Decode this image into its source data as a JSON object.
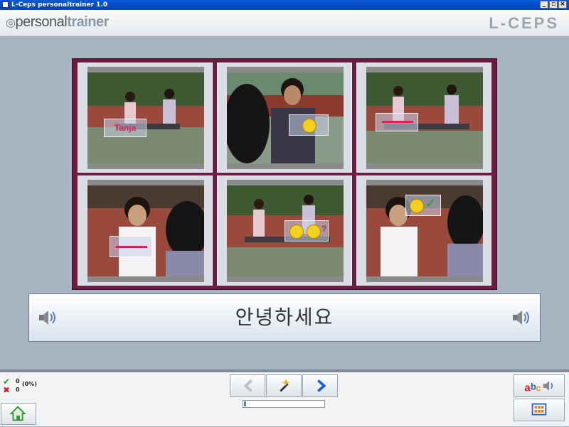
{
  "window": {
    "title": "L-Ceps personaltrainer 1.0"
  },
  "header": {
    "logo_left_part1": "personal",
    "logo_left_part2": "trainer",
    "logo_right": "L-CEPS"
  },
  "tiles": [
    {
      "overlay_text": "Tanja"
    },
    {
      "overlay_text": ""
    },
    {
      "overlay_text": ""
    },
    {
      "overlay_text": ""
    },
    {
      "overlay_text": ""
    },
    {
      "overlay_text": ""
    }
  ],
  "phrase": {
    "text": "안녕하세요"
  },
  "score": {
    "correct": "0",
    "wrong": "0",
    "percent": "(0%)"
  },
  "progress": {
    "value": 0.03
  },
  "icons": {
    "speaker_left": "speaker-icon",
    "speaker_right": "speaker-icon",
    "back": "arrow-left-icon",
    "hint": "magic-wand-icon",
    "next": "arrow-right-icon",
    "home": "home-icon",
    "abc_audio": "abc-audio-icon",
    "grid": "grid-icon"
  },
  "colors": {
    "frame": "#6b1c40",
    "accent_blue": "#1e5fd8",
    "background": "#a7b5c2"
  }
}
